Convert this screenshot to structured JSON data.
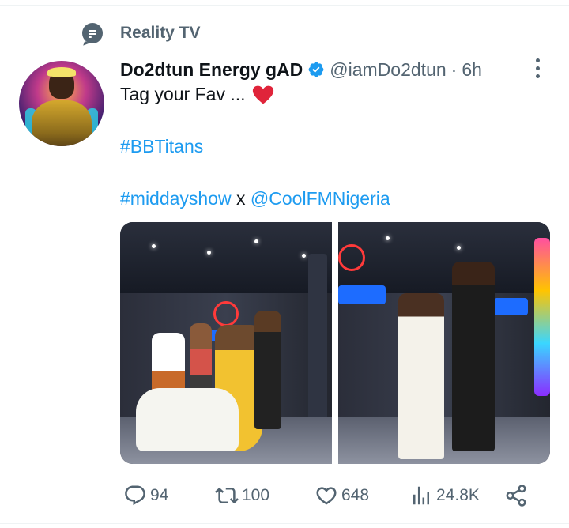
{
  "context": {
    "label": "Reality TV",
    "icon": "topic-icon"
  },
  "author": {
    "display_name": "Do2dtun Energy gAD",
    "handle": "@iamDo2dtun",
    "separator": "·",
    "time": "6h",
    "verified": true
  },
  "tweet": {
    "line1": "Tag your Fav ...",
    "hashtag1": "#BBTitans",
    "hashtag2": "#middayshow",
    "connector": "x",
    "mention": "@CoolFMNigeria"
  },
  "media": {
    "count": 2
  },
  "actions": {
    "replies": "94",
    "retweets": "100",
    "likes": "648",
    "views": "24.8K"
  },
  "colors": {
    "accent": "#1d9bf0",
    "muted": "#536471",
    "heart": "#f91880",
    "text": "#0f1419"
  }
}
